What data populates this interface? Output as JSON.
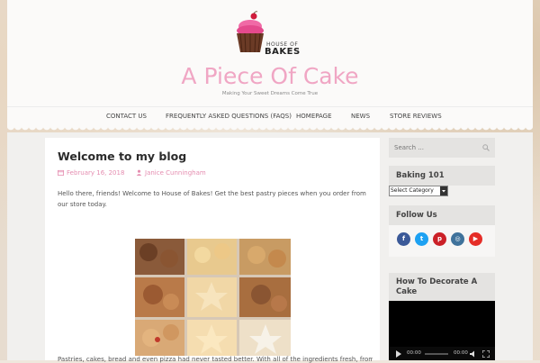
{
  "site": {
    "logo_text_top": "HOUSE OF",
    "logo_text_bottom": "BAKES",
    "title": "A Piece Of Cake",
    "tagline": "Making Your Sweet Dreams Come True"
  },
  "nav": {
    "items": [
      "CONTACT US",
      "FREQUENTLY ASKED QUESTIONS (FAQS)",
      "HOMEPAGE",
      "NEWS",
      "STORE REVIEWS"
    ]
  },
  "post": {
    "title": "Welcome to my blog",
    "date": "February 16, 2018",
    "author": "Janice Cunningham",
    "intro": "Hello there, friends!  Welcome to House of Bakes! Get the best pastry pieces when you order from our store today.",
    "bottom": "Pastries, cakes, bread and even pizza had never tasted better. With all of the ingredients fresh, from the"
  },
  "sidebar": {
    "search_placeholder": "Search ...",
    "baking_title": "Baking 101",
    "select_value": "Select Category",
    "follow_title": "Follow Us",
    "social": [
      {
        "name": "facebook-icon",
        "color": "#3b5998",
        "glyph": "f"
      },
      {
        "name": "twitter-icon",
        "color": "#1da1f2",
        "glyph": "t"
      },
      {
        "name": "pinterest-icon",
        "color": "#cb2027",
        "glyph": "p"
      },
      {
        "name": "instagram-icon",
        "color": "#3f729b",
        "glyph": "◎"
      },
      {
        "name": "youtube-icon",
        "color": "#e52d27",
        "glyph": "▶"
      }
    ],
    "decorate_title": "How To Decorate A Cake",
    "video_time_current": "00:00",
    "video_time_total": "00:00"
  },
  "colors": {
    "accent": "#f0a6c4",
    "meta": "#e58db0"
  }
}
